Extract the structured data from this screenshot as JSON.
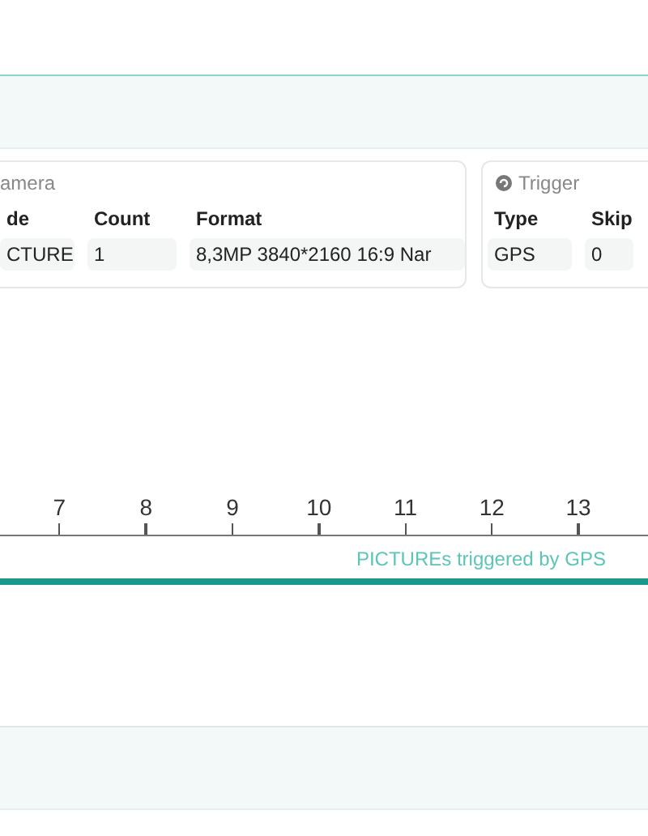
{
  "camera": {
    "title": "amera",
    "columns": [
      {
        "header": "de",
        "value": "CTURE"
      },
      {
        "header": "Count",
        "value": "1"
      },
      {
        "header": "Format",
        "value": "8,3MP 3840*2160 16:9 Nar"
      }
    ]
  },
  "trigger": {
    "title": "Trigger",
    "columns": [
      {
        "header": "Type",
        "value": "GPS"
      },
      {
        "header": "Skip",
        "value": "0"
      }
    ]
  },
  "timeline": {
    "ticks": [
      "7",
      "8",
      "9",
      "10",
      "11",
      "12",
      "13"
    ],
    "caption": "PICTUREs triggered by GPS"
  }
}
